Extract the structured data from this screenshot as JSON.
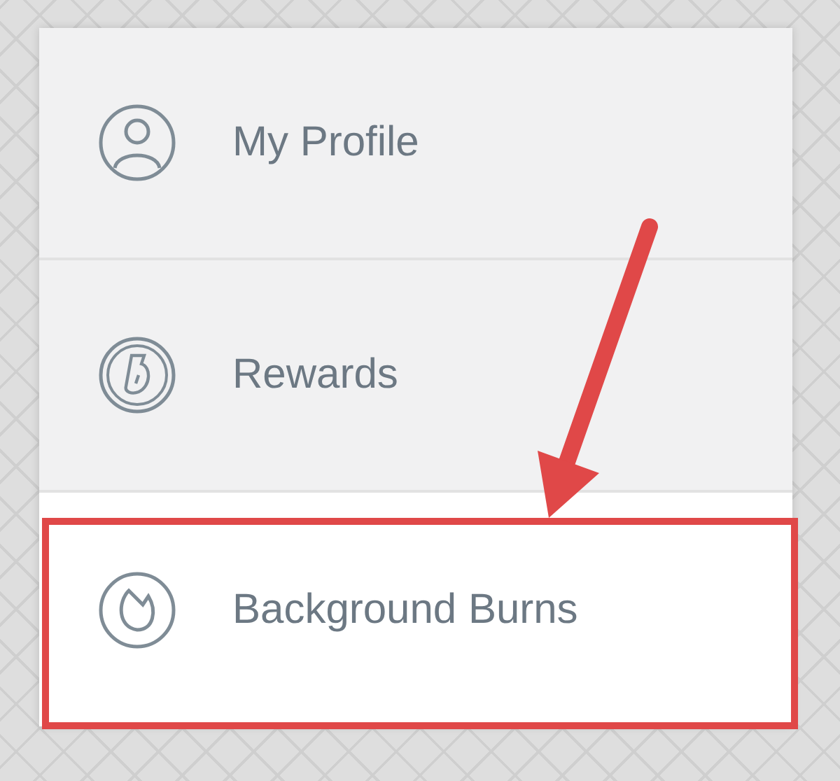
{
  "menu": {
    "items": [
      {
        "label": "My Profile",
        "selected": false,
        "highlighted": false
      },
      {
        "label": "Rewards",
        "selected": false,
        "highlighted": false
      },
      {
        "label": "Background Burns",
        "selected": true,
        "highlighted": true
      }
    ]
  }
}
